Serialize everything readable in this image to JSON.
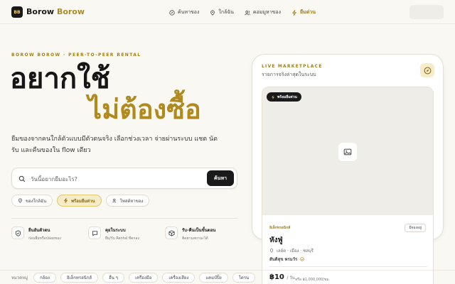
{
  "header": {
    "logo_badge": "BB",
    "brand_part1": "Borow",
    "brand_part2": "Borow",
    "nav": [
      {
        "label": "ค้นหาของ",
        "icon": "compass-icon"
      },
      {
        "label": "ใกล้ฉัน",
        "icon": "map-pin-icon"
      },
      {
        "label": "คอมมูหาของ",
        "icon": "users-icon"
      },
      {
        "label": "ยืมด่วน",
        "icon": "bolt-icon",
        "active": true
      }
    ]
  },
  "hero": {
    "eyebrow": "BOROW BOROW · PEER-TO-PEER RENTAL",
    "headline_line1": "อยากใช้",
    "headline_line2": "ไม่ต้องซื้อ",
    "description": "ยืมของจากคนใกล้ตัวแบบมีตัวตนจริง เลือกช่วงเวลา จ่ายผ่านระบบ แชต นัดรับ และคืนของใน flow เดียว"
  },
  "search": {
    "placeholder": "วันนี้อยากยืมอะไร?",
    "button_label": "ค้นหา"
  },
  "chips": [
    {
      "label": "ของใกล้ฉัน",
      "icon": "map-pin-icon",
      "active": false
    },
    {
      "label": "พร้อมยืมด่วน",
      "icon": "bolt-icon",
      "active": true
    },
    {
      "label": "โพสต์หาของ",
      "icon": "users-icon",
      "active": false
    }
  ],
  "features": [
    {
      "title": "ยืนยันตัวตน",
      "subtitle": "ก่อนยืมหรือปล่อยของ",
      "icon": "shield-icon"
    },
    {
      "title": "คุยในระบบ",
      "subtitle": "ยืม/รับ Rental ที่ตกลง",
      "icon": "chat-icon"
    },
    {
      "title": "รับ-คืนเป็นขั้นตอน",
      "subtitle": "ติดตามสถานะได้",
      "icon": "box-icon"
    }
  ],
  "categories": {
    "label": "หมวดหมู่",
    "items": [
      "กล้อง",
      "อิเล็กทรอนิกส์",
      "อื่น ๆ",
      "เครื่องมือ",
      "เครื่องเสียง",
      "แคมป์ปิ้ง",
      "โดรน"
    ]
  },
  "marketplace": {
    "title": "LIVE MARKETPLACE",
    "subtitle": "รายการจริงล่าสุดในระบบ",
    "icon": "compass-icon"
  },
  "listing": {
    "badge": "พร้อมยืมด่วน",
    "image_icon": "image-icon",
    "category": "อิเล็กทรอนิกส์",
    "status": "มีจองอยู่",
    "title": "หังฟู่",
    "location": "เลย์ด · เมือง · ชลบุรี",
    "owner": "สันติสุข พรมวัร",
    "price": "฿10",
    "price_unit": "/ วัน",
    "deposit": "หรือ ฿1,000,000/ชม."
  },
  "colors": {
    "accent": "#b08a1c",
    "dark": "#1a1a1a",
    "background": "#faf8f2",
    "chip_active_bg": "#f6ecc8"
  }
}
